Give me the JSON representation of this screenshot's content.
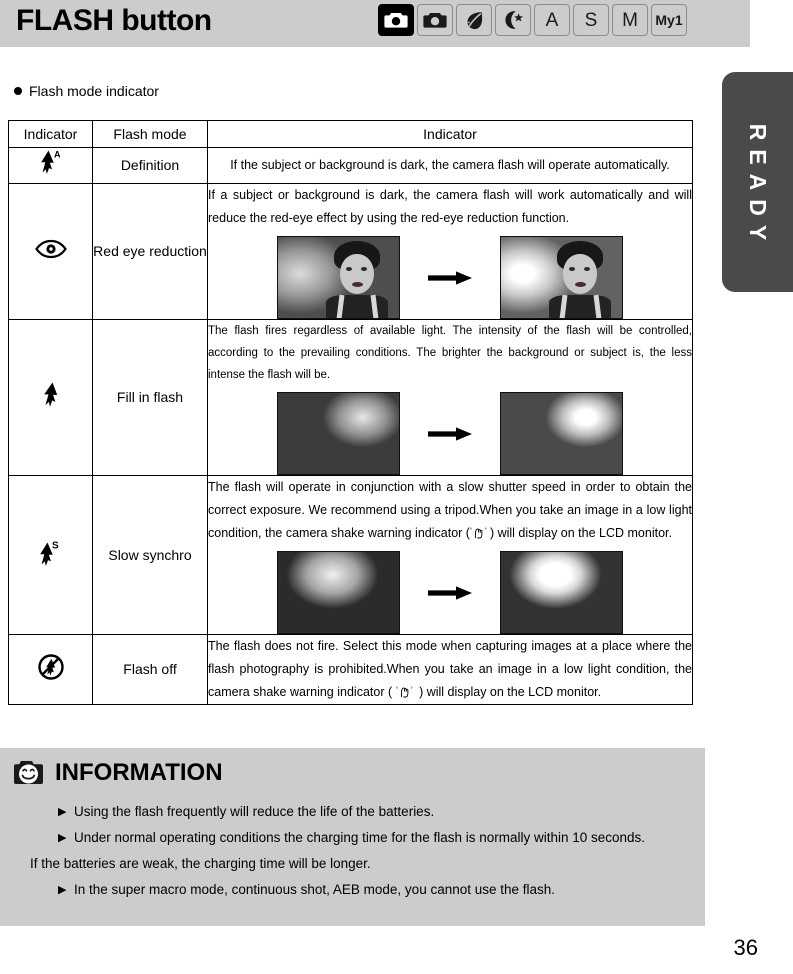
{
  "header": {
    "title": "FLASH button",
    "mode_icons": [
      {
        "name": "auto-camera-mode-icon",
        "label": "",
        "glyph": "camera",
        "selected": true
      },
      {
        "name": "program-camera-mode-icon",
        "label": "",
        "glyph": "camera",
        "selected": false
      },
      {
        "name": "scene-mode-icon",
        "label": "",
        "glyph": "leaf",
        "selected": false
      },
      {
        "name": "night-mode-icon",
        "label": "",
        "glyph": "moon-star",
        "selected": false
      },
      {
        "name": "aperture-priority-mode-icon",
        "label": "A",
        "glyph": "text",
        "selected": false
      },
      {
        "name": "shutter-priority-mode-icon",
        "label": "S",
        "glyph": "text",
        "selected": false
      },
      {
        "name": "manual-mode-icon",
        "label": "M",
        "glyph": "text",
        "selected": false
      },
      {
        "name": "my-set-mode-icon",
        "label": "My1",
        "glyph": "text",
        "selected": false
      }
    ]
  },
  "side_tab": {
    "label": "READY"
  },
  "section": {
    "bullet_heading": "Flash mode indicator"
  },
  "table": {
    "headers": [
      "Indicator",
      "Flash mode",
      "Indicator"
    ],
    "rows": [
      {
        "icon_name": "flash-auto-icon",
        "mode": "Definition",
        "description": "If the subject or background is dark, the camera flash will operate automatically.",
        "has_photos": false
      },
      {
        "icon_name": "red-eye-reduction-icon",
        "mode": "Red eye reduction",
        "description": "If a subject or background is dark, the camera flash will work automatically and will reduce the red-eye effect by using the red-eye reduction function.",
        "has_photos": true
      },
      {
        "icon_name": "fill-in-flash-icon",
        "mode": "Fill in flash",
        "description": "The flash fires regardless of available light. The intensity of the flash will be controlled, according to the prevailing conditions. The brighter the background or subject is, the less intense the flash will be.",
        "has_photos": true
      },
      {
        "icon_name": "slow-synchro-flash-icon",
        "mode": "Slow synchro",
        "description_part1": "The flash will operate in conjunction with a slow shutter speed in order to obtain the correct exposure. We recommend using a tripod.When you take an image in a low light condition, the camera shake warning indicator (",
        "description_part2": ") will display on the LCD monitor.",
        "has_photos": true
      },
      {
        "icon_name": "flash-off-icon",
        "mode": "Flash off",
        "description_part1": "The flash does not fire. Select this mode when capturing images at a place where the flash photography is prohibited.When you take an image in a low light condition, the camera shake warning indicator ( ",
        "description_part2": " ) will display on the LCD monitor.",
        "has_photos": false
      }
    ]
  },
  "information": {
    "title": "INFORMATION",
    "icon_name": "camera-smiley-icon",
    "bullet_marker": "▶",
    "items": [
      {
        "type": "bullet",
        "text": "Using the flash frequently will reduce the life of the batteries."
      },
      {
        "type": "bullet",
        "text": "Under normal operating conditions the charging time for the flash is normally within 10 seconds."
      },
      {
        "type": "plain",
        "text": "If the batteries are weak, the charging time will be longer."
      },
      {
        "type": "bullet",
        "text": "In the super macro mode, continuous shot, AEB mode, you cannot use the flash."
      }
    ]
  },
  "footer": {
    "page_number": "36"
  },
  "colors": {
    "header_bar": "#cccccc",
    "info_bar": "#cccccc",
    "side_tab": "#4a4a4a",
    "text": "#000000"
  }
}
